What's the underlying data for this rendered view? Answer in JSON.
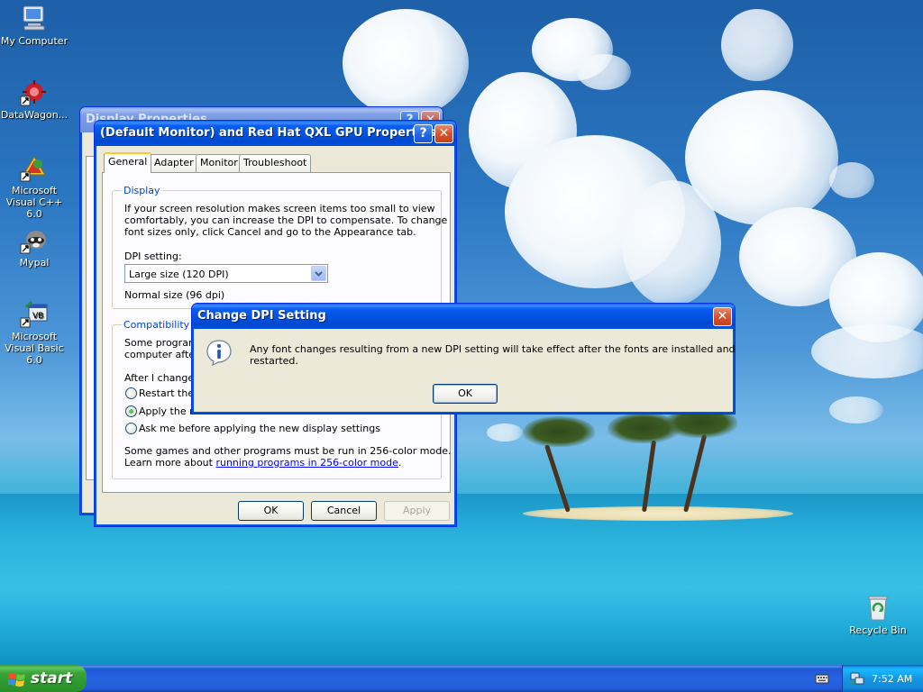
{
  "desktop": {
    "icons": [
      {
        "label": "My Computer",
        "icon": "my-computer-icon"
      },
      {
        "label": "DataWagon...",
        "icon": "datawagon-shortcut-icon"
      },
      {
        "label": "Microsoft Visual C++ 6.0",
        "icon": "visual-cpp-shortcut-icon"
      },
      {
        "label": "Mypal",
        "icon": "mypal-shortcut-icon"
      },
      {
        "label": "Microsoft Visual Basic 6.0",
        "icon": "visual-basic-shortcut-icon"
      },
      {
        "label": "Recycle Bin",
        "icon": "recycle-bin-icon"
      }
    ]
  },
  "display_properties": {
    "title": "Display Properties"
  },
  "gpu_properties": {
    "title": "(Default Monitor) and Red Hat QXL GPU Properties",
    "tabs": [
      "General",
      "Adapter",
      "Monitor",
      "Troubleshoot"
    ],
    "display_group": {
      "label": "Display",
      "description_lines": [
        "If your screen resolution makes screen items too small to view",
        "comfortably, you can increase the DPI to compensate.  To change",
        "font sizes only, click Cancel and go to the Appearance tab."
      ],
      "dpi_label": "DPI setting:",
      "dpi_value": "Large size (120 DPI)",
      "normal_size": "Normal size (96 dpi)"
    },
    "compat_group": {
      "label": "Compatibility",
      "lines": [
        "Some programs",
        "computer after"
      ],
      "after_change": "After I change",
      "radio_options": [
        "Restart the",
        "Apply the ne",
        "Ask me before applying the new display settings"
      ],
      "selected_index": 1,
      "footer_line1": "Some games and other programs must be run in 256-color mode.",
      "footer_prefix": "Learn more about ",
      "footer_link": "running programs in 256-color mode",
      "footer_suffix": "."
    },
    "buttons": {
      "ok": "OK",
      "cancel": "Cancel",
      "apply": "Apply"
    }
  },
  "dialog": {
    "title": "Change DPI Setting",
    "message_line1": "Any font changes resulting from a new DPI setting will take effect after the fonts are installed and Windows is",
    "message_line2": "restarted.",
    "ok": "OK"
  },
  "taskbar": {
    "start_label": "start",
    "clock": "7:52 AM"
  }
}
